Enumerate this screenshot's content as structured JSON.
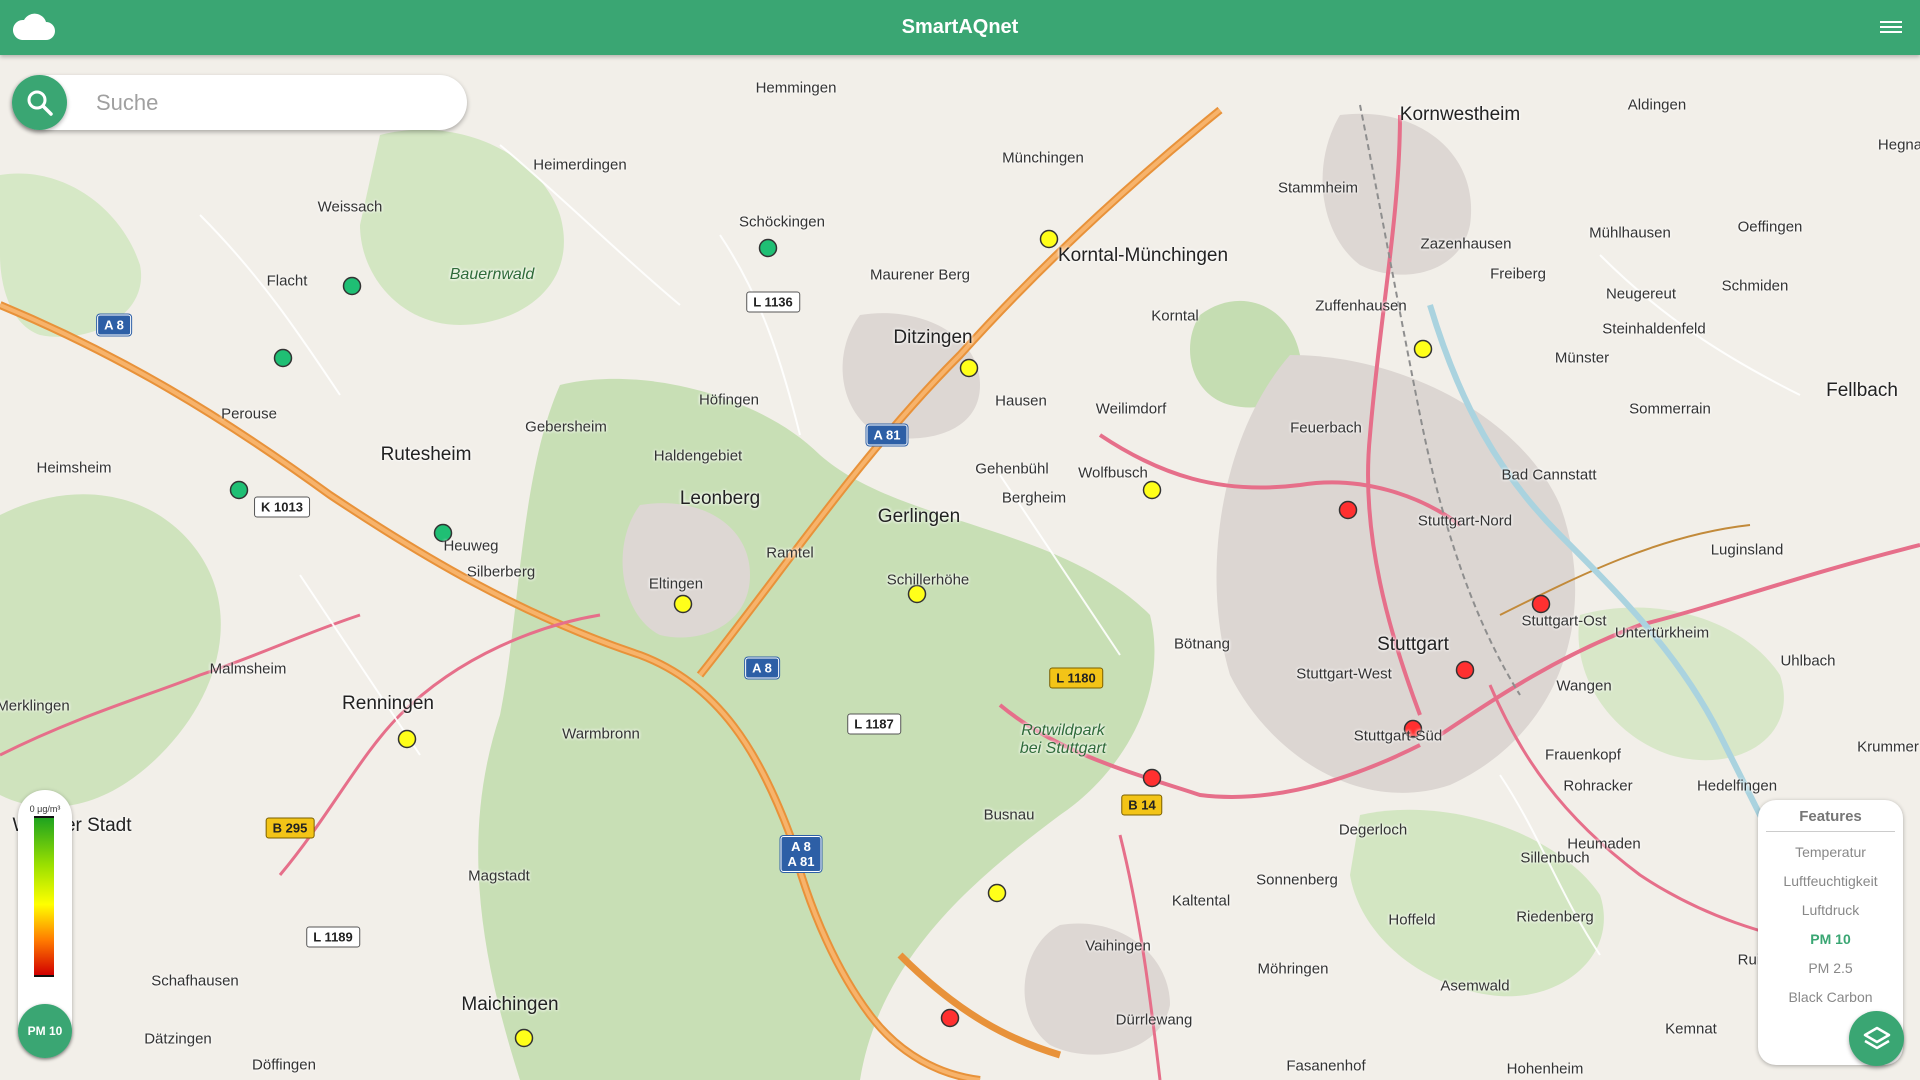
{
  "header": {
    "title": "SmartAQnet",
    "logo_icon": "cloud-icon",
    "menu_icon": "hamburger-menu-icon"
  },
  "search": {
    "placeholder": "Suche",
    "value": ""
  },
  "legend": {
    "unit": "0 μg/m³",
    "selected": "PM 10"
  },
  "features": {
    "title": "Features",
    "items": [
      "Temperatur",
      "Luftfeuchtigkeit",
      "Luftdruck",
      "PM 10",
      "PM 2.5",
      "Black Carbon"
    ],
    "active": "PM 10"
  },
  "colors": {
    "primary": "#3aa673",
    "sensor_green": "#1fbf74",
    "sensor_yellow": "#ffff1a",
    "sensor_red": "#ff3030"
  },
  "map": {
    "places": [
      {
        "name": "Hemmingen"
      },
      {
        "name": "Kornwestheim"
      },
      {
        "name": "Aldingen"
      },
      {
        "name": "Hegna"
      },
      {
        "name": "Heimerdingen"
      },
      {
        "name": "Münchingen"
      },
      {
        "name": "Stammheim"
      },
      {
        "name": "Mühlhausen"
      },
      {
        "name": "Oeffingen"
      },
      {
        "name": "Weissach"
      },
      {
        "name": "Schöckingen"
      },
      {
        "name": "Korntal-Münchingen"
      },
      {
        "name": "Zazenhausen"
      },
      {
        "name": "Bauernwald"
      },
      {
        "name": "Flacht"
      },
      {
        "name": "Maurener Berg"
      },
      {
        "name": "Freiberg"
      },
      {
        "name": "Schmiden"
      },
      {
        "name": "Zuffenhausen"
      },
      {
        "name": "Neugereut"
      },
      {
        "name": "Korntal"
      },
      {
        "name": "Ditzingen"
      },
      {
        "name": "Steinhaldenfeld"
      },
      {
        "name": "Münster"
      },
      {
        "name": "Höfingen"
      },
      {
        "name": "Hausen"
      },
      {
        "name": "Fellbach"
      },
      {
        "name": "Sommerrain"
      },
      {
        "name": "Perouse"
      },
      {
        "name": "Weilimdorf"
      },
      {
        "name": "Gebersheim"
      },
      {
        "name": "Feuerbach"
      },
      {
        "name": "Heimsheim"
      },
      {
        "name": "Rutesheim"
      },
      {
        "name": "Haldengebiet"
      },
      {
        "name": "Gehenbühl"
      },
      {
        "name": "Wolfbusch"
      },
      {
        "name": "Bad Cannstatt"
      },
      {
        "name": "Leonberg"
      },
      {
        "name": "Bergheim"
      },
      {
        "name": "Gerlingen"
      },
      {
        "name": "Stuttgart-Nord"
      },
      {
        "name": "Heuweg"
      },
      {
        "name": "Silberberg"
      },
      {
        "name": "Ramtel"
      },
      {
        "name": "Luginsland"
      },
      {
        "name": "Schillerhöhe"
      },
      {
        "name": "Eltingen"
      },
      {
        "name": "Stuttgart-Ost"
      },
      {
        "name": "Untertürkheim"
      },
      {
        "name": "Bötnang"
      },
      {
        "name": "Stuttgart"
      },
      {
        "name": "Malmsheim"
      },
      {
        "name": "Uhlbach"
      },
      {
        "name": "Stuttgart-West"
      },
      {
        "name": "Renningen"
      },
      {
        "name": "Wangen"
      },
      {
        "name": "Merklingen"
      },
      {
        "name": "Warmbronn"
      },
      {
        "name": "Stuttgart-Süd"
      },
      {
        "name": "Krummer"
      },
      {
        "name": "Rotwildpark\nbei Stuttgart"
      },
      {
        "name": "Frauenkopf"
      },
      {
        "name": "Rohracker"
      },
      {
        "name": "Hedelfingen"
      },
      {
        "name": "Weil der Stadt"
      },
      {
        "name": "Busnau"
      },
      {
        "name": "Degerloch"
      },
      {
        "name": "Heumaden"
      },
      {
        "name": "Sillenbuch"
      },
      {
        "name": "Magstadt"
      },
      {
        "name": "Sonnenberg"
      },
      {
        "name": "Kaltental"
      },
      {
        "name": "Hoffeld"
      },
      {
        "name": "Riedenberg"
      },
      {
        "name": "Vaihingen"
      },
      {
        "name": "Ruit"
      },
      {
        "name": "Schafhausen"
      },
      {
        "name": "Möhringen"
      },
      {
        "name": "Asemwald"
      },
      {
        "name": "Maichingen"
      },
      {
        "name": "Dürrlewang"
      },
      {
        "name": "Kemnat"
      },
      {
        "name": "Dätzingen"
      },
      {
        "name": "Döffingen"
      },
      {
        "name": "Fasanenhof"
      },
      {
        "name": "Hohenheim"
      }
    ],
    "roads": [
      {
        "label": "A 8",
        "type": "a"
      },
      {
        "label": "A 81",
        "type": "a"
      },
      {
        "label": "A 8",
        "type": "a"
      },
      {
        "label": "A 8\nA 81",
        "type": "a"
      },
      {
        "label": "L 1136",
        "type": "l"
      },
      {
        "label": "K 1013",
        "type": "l"
      },
      {
        "label": "L 1187",
        "type": "l"
      },
      {
        "label": "L 1189",
        "type": "l"
      },
      {
        "label": "L 1180",
        "type": "b"
      },
      {
        "label": "B 14",
        "type": "b"
      },
      {
        "label": "B 295",
        "type": "b"
      }
    ],
    "sensor_levels": [
      "green",
      "green",
      "green",
      "green",
      "green",
      "yellow",
      "yellow",
      "yellow",
      "yellow",
      "yellow",
      "yellow",
      "yellow",
      "yellow",
      "yellow",
      "yellow",
      "red",
      "red",
      "red",
      "red",
      "red",
      "red"
    ]
  }
}
